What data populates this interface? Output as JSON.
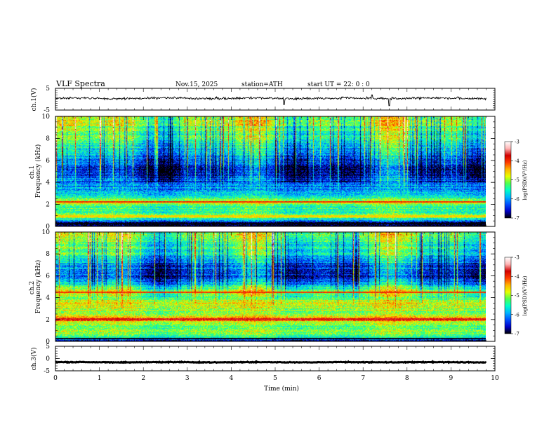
{
  "header": {
    "title": "VLF  Spectra",
    "date": "Nov.15, 2025",
    "station": "station=ATH",
    "start_ut": "start  UT  =    22: 0   : 0"
  },
  "chart_data": [
    {
      "id": "ch1-waveform",
      "type": "line",
      "ylabel": "ch.1(V)",
      "ylim": [
        -5,
        5
      ],
      "y_ticks": [
        "5",
        "-5"
      ],
      "xlim": [
        0,
        10
      ],
      "data_extent_min": 9.8,
      "baseline_v": 0.4,
      "noise_amplitude_v": 0.8,
      "spikes": [
        {
          "t": 5.2,
          "v": -2.5
        },
        {
          "t": 7.2,
          "v": 2.0
        },
        {
          "t": 7.6,
          "v": -3.0
        }
      ]
    },
    {
      "id": "ch1-spectrogram",
      "type": "heatmap",
      "ylabel": "ch.1\nFrequency (kHz)",
      "ylim": [
        0,
        10
      ],
      "y_ticks": [
        "0",
        "2",
        "4",
        "6",
        "8",
        "10"
      ],
      "xlim": [
        0,
        10
      ],
      "data_extent_min": 9.8,
      "colorbar": {
        "label": "log(PSD)(V²/Hz)",
        "range": [
          -7,
          -3
        ],
        "ticks": [
          "-3",
          "-4",
          "-5",
          "-6",
          "-7"
        ]
      },
      "profile": [
        {
          "f": 0.0,
          "v": -7.0
        },
        {
          "f": 0.3,
          "v": -6.8
        },
        {
          "f": 0.6,
          "v": -5.6
        },
        {
          "f": 0.9,
          "v": -4.9
        },
        {
          "f": 1.3,
          "v": -5.6
        },
        {
          "f": 1.8,
          "v": -5.4
        },
        {
          "f": 2.2,
          "v": -4.6
        },
        {
          "f": 2.6,
          "v": -5.5
        },
        {
          "f": 3.0,
          "v": -5.8
        },
        {
          "f": 3.5,
          "v": -6.0
        },
        {
          "f": 4.0,
          "v": -6.3
        },
        {
          "f": 5.0,
          "v": -6.6
        },
        {
          "f": 6.0,
          "v": -6.3
        },
        {
          "f": 7.0,
          "v": -5.8
        },
        {
          "f": 8.0,
          "v": -5.4
        },
        {
          "f": 9.0,
          "v": -5.1
        },
        {
          "f": 10.0,
          "v": -4.9
        }
      ],
      "lines": [
        {
          "f": 0.2,
          "v": -7.0
        },
        {
          "f": 2.2,
          "v": -4.0
        },
        {
          "f": 0.9,
          "v": -4.6
        }
      ]
    },
    {
      "id": "ch2-spectrogram",
      "type": "heatmap",
      "ylabel": "ch.2\nFrequency (kHz)",
      "ylim": [
        0,
        10
      ],
      "y_ticks": [
        "0",
        "2",
        "4",
        "6",
        "8",
        "10"
      ],
      "xlim": [
        0,
        10
      ],
      "data_extent_min": 9.8,
      "colorbar": {
        "label": "log(PSD)(V²/Hz)",
        "range": [
          -7,
          -3
        ],
        "ticks": [
          "-3",
          "-4",
          "-5",
          "-6",
          "-7"
        ]
      },
      "profile": [
        {
          "f": 0.0,
          "v": -6.8
        },
        {
          "f": 0.4,
          "v": -5.4
        },
        {
          "f": 0.8,
          "v": -5.0
        },
        {
          "f": 1.2,
          "v": -5.3
        },
        {
          "f": 1.6,
          "v": -5.0
        },
        {
          "f": 2.0,
          "v": -4.2
        },
        {
          "f": 2.4,
          "v": -5.0
        },
        {
          "f": 3.0,
          "v": -5.0
        },
        {
          "f": 3.5,
          "v": -4.6
        },
        {
          "f": 4.0,
          "v": -5.3
        },
        {
          "f": 4.6,
          "v": -4.8
        },
        {
          "f": 5.2,
          "v": -5.8
        },
        {
          "f": 6.0,
          "v": -6.4
        },
        {
          "f": 7.0,
          "v": -6.2
        },
        {
          "f": 8.0,
          "v": -5.6
        },
        {
          "f": 9.0,
          "v": -5.3
        },
        {
          "f": 10.0,
          "v": -5.0
        }
      ],
      "lines": [
        {
          "f": 0.2,
          "v": -7.0
        },
        {
          "f": 2.0,
          "v": -3.7
        },
        {
          "f": 4.5,
          "v": -4.0
        }
      ]
    },
    {
      "id": "ch3-waveform",
      "type": "line",
      "ylabel": "ch.3(V)",
      "ylim": [
        -5,
        5
      ],
      "y_ticks": [
        "5",
        "0",
        "-5"
      ],
      "xlim": [
        0,
        10
      ],
      "x_ticks": [
        "0",
        "1",
        "2",
        "3",
        "4",
        "5",
        "6",
        "7",
        "8",
        "9",
        "10"
      ],
      "xlabel": "Time  (min)",
      "data_extent_min": 9.8,
      "baseline_v": -1.5,
      "noise_amplitude_v": 0.25
    }
  ],
  "colors": {
    "colormap": [
      "#000000",
      "#0000c8",
      "#0050ff",
      "#00b4ff",
      "#00ffc8",
      "#50ff50",
      "#e6ff00",
      "#ffb400",
      "#ff3c00",
      "#d20000",
      "#ffb4b4",
      "#ffffff"
    ]
  }
}
